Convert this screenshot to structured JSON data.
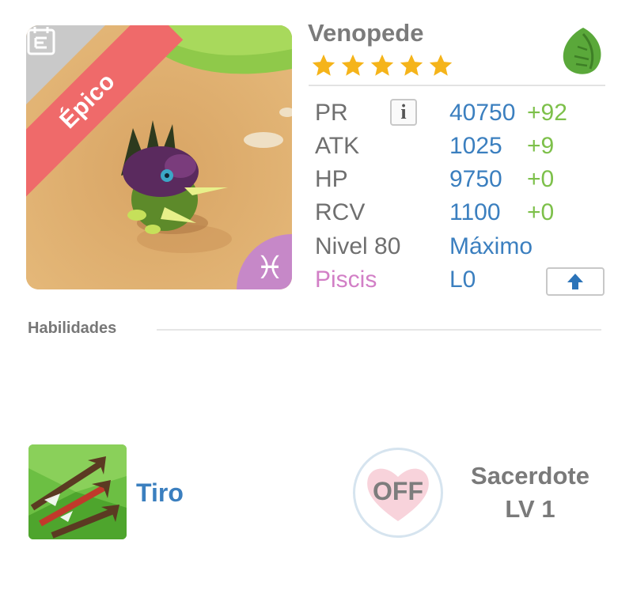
{
  "monster": {
    "name": "Venopede",
    "rarity": "Épico",
    "stars": 5,
    "element_icon": "leaf-icon",
    "zodiac_icon": "pisces-icon",
    "zodiac_glyph": "♓"
  },
  "stats": {
    "pr": {
      "label": "PR",
      "value": "40750",
      "bonus": "+92"
    },
    "atk": {
      "label": "ATK",
      "value": "1025",
      "bonus": "+9"
    },
    "hp": {
      "label": "HP",
      "value": "9750",
      "bonus": "+0"
    },
    "rcv": {
      "label": "RCV",
      "value": "1100",
      "bonus": "+0"
    },
    "level": {
      "label": "Nivel 80",
      "value": "Máximo"
    },
    "sign": {
      "label": "Piscis",
      "value": "L0"
    }
  },
  "info_button": {
    "label": "i"
  },
  "abilities": {
    "title": "Habilidades",
    "skill_name": "Tiro",
    "toggle_label": "OFF",
    "leader_name": "Sacerdote",
    "leader_level": "LV 1"
  },
  "colors": {
    "value_blue": "#3b7fbf",
    "bonus_green": "#7dc04a",
    "rarity_red": "#ef6a6a",
    "zodiac_purple": "#c688c8"
  }
}
